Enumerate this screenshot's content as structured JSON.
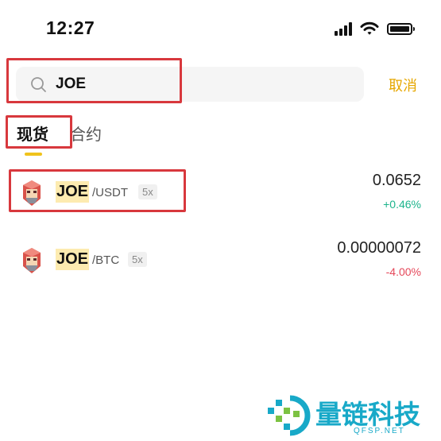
{
  "status_bar": {
    "time": "12:27"
  },
  "search": {
    "value": "JOE",
    "placeholder": ""
  },
  "cancel_label": "取消",
  "tabs": [
    {
      "label": "现货",
      "active": true
    },
    {
      "label": "合约",
      "active": false
    }
  ],
  "results": [
    {
      "symbol": "JOE",
      "quote": "/USDT",
      "leverage": "5x",
      "price": "0.0652",
      "change": "+0.46%",
      "change_color": "#1db48c"
    },
    {
      "symbol": "JOE",
      "quote": "/BTC",
      "leverage": "5x",
      "price": "0.00000072",
      "change": "-4.00%",
      "change_color": "#e5485a"
    }
  ],
  "watermark": {
    "title": "量链科技",
    "subtitle": "QFSP.NET"
  },
  "colors": {
    "accent": "#e6a700",
    "tab_indicator": "#f0c31c",
    "annotation": "#d8383d",
    "positive": "#1db48c",
    "negative": "#e5485a",
    "watermark": "#18a9c8"
  },
  "icons": {
    "status": [
      "signal-icon",
      "wifi-icon",
      "battery-icon"
    ],
    "search": "search-icon",
    "coin": "joe-coin-icon",
    "watermark": "qfsp-logo-icon"
  }
}
